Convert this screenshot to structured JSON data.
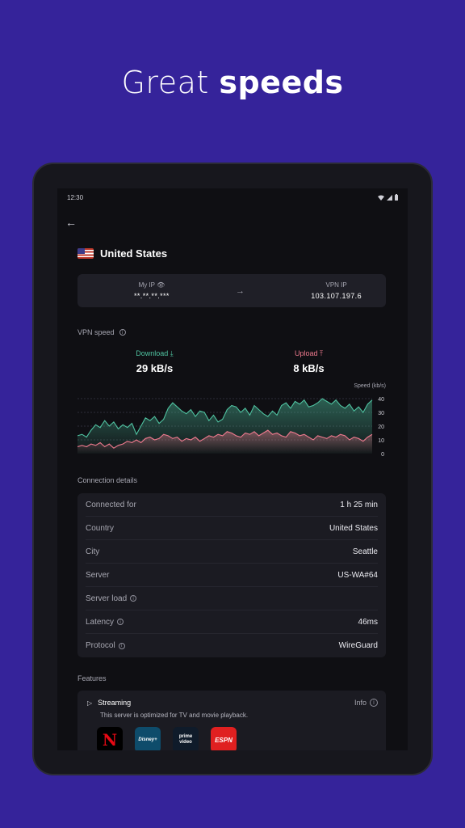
{
  "headline": {
    "light": "Great",
    "bold": "speeds"
  },
  "status_bar": {
    "time": "12:30"
  },
  "location": {
    "country": "United States"
  },
  "ip": {
    "my_ip_label": "My IP",
    "my_ip_value": "**.**.**.***",
    "vpn_ip_label": "VPN IP",
    "vpn_ip_value": "103.107.197.6"
  },
  "vpn_speed": {
    "label": "VPN speed",
    "download_label": "Download",
    "download_value": "29 kB/s",
    "upload_label": "Upload",
    "upload_value": "8 kB/s"
  },
  "colors": {
    "download": "#4fc2a0",
    "upload": "#ef7a8e",
    "background": "#35239a"
  },
  "chart_data": {
    "type": "area",
    "ylabel": "Speed (kb/s)",
    "ylim": [
      0,
      40
    ],
    "yticks": [
      0,
      10,
      20,
      30,
      40
    ],
    "grid": true,
    "series": [
      {
        "name": "Download",
        "values": [
          13,
          14,
          12,
          17,
          21,
          19,
          24,
          20,
          23,
          18,
          21,
          19,
          22,
          14,
          20,
          26,
          24,
          27,
          22,
          25,
          33,
          37,
          34,
          31,
          29,
          32,
          27,
          31,
          30,
          24,
          28,
          23,
          25,
          32,
          35,
          34,
          30,
          33,
          28,
          35,
          32,
          29,
          27,
          31,
          28,
          35,
          37,
          33,
          38,
          36,
          39,
          34,
          35,
          37,
          40,
          38,
          36,
          39,
          35,
          33,
          36,
          31,
          34,
          30,
          36,
          39
        ]
      },
      {
        "name": "Upload",
        "values": [
          5,
          6,
          5,
          7,
          6,
          8,
          5,
          7,
          4,
          6,
          7,
          9,
          8,
          10,
          8,
          11,
          12,
          10,
          11,
          14,
          13,
          11,
          12,
          9,
          11,
          10,
          12,
          9,
          11,
          13,
          12,
          14,
          13,
          16,
          15,
          13,
          12,
          15,
          14,
          16,
          13,
          15,
          17,
          14,
          15,
          13,
          12,
          16,
          15,
          13,
          14,
          12,
          10,
          13,
          12,
          11,
          13,
          12,
          14,
          13,
          10,
          12,
          11,
          9,
          12,
          14
        ]
      }
    ]
  },
  "connection_details": {
    "label": "Connection details",
    "rows": [
      {
        "label": "Connected for",
        "value": "1 h 25 min"
      },
      {
        "label": "Country",
        "value": "United States"
      },
      {
        "label": "City",
        "value": "Seattle"
      },
      {
        "label": "Server",
        "value": "US-WA#64"
      },
      {
        "label": "Server load",
        "value": ""
      },
      {
        "label": "Latency",
        "value": "46ms"
      },
      {
        "label": "Protocol",
        "value": "WireGuard"
      }
    ]
  },
  "features": {
    "label": "Features",
    "streaming": {
      "title": "Streaming",
      "info_label": "Info",
      "description": "This server is optimized for TV and movie playback.",
      "logos": [
        {
          "name": "netflix",
          "text": "N"
        },
        {
          "name": "disney",
          "text": "Disney+"
        },
        {
          "name": "prime",
          "text": "prime video"
        },
        {
          "name": "espn",
          "text": "ESPN"
        }
      ]
    }
  }
}
